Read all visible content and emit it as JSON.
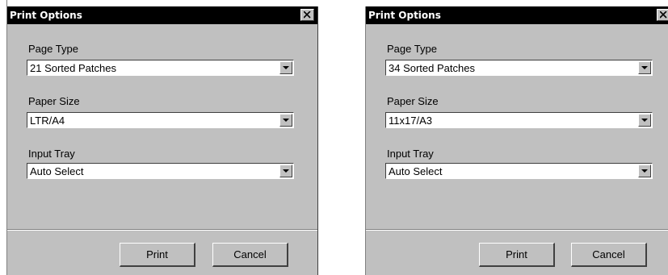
{
  "dialogs": [
    {
      "title": "Print Options",
      "fields": [
        {
          "label": "Page Type",
          "value": "21 Sorted Patches"
        },
        {
          "label": "Paper Size",
          "value": "LTR/A4"
        },
        {
          "label": "Input Tray",
          "value": "Auto Select"
        }
      ],
      "buttons": {
        "print": "Print",
        "cancel": "Cancel"
      }
    },
    {
      "title": "Print Options",
      "fields": [
        {
          "label": "Page Type",
          "value": "34 Sorted Patches"
        },
        {
          "label": "Paper Size",
          "value": "11x17/A3"
        },
        {
          "label": "Input Tray",
          "value": "Auto Select"
        }
      ],
      "buttons": {
        "print": "Print",
        "cancel": "Cancel"
      }
    }
  ],
  "icons": {
    "close": "close-icon",
    "dropdown": "chevron-down-icon"
  },
  "colors": {
    "titlebar": "#000000",
    "title_text": "#ffffff",
    "dialog_face": "#c0c0c0"
  }
}
